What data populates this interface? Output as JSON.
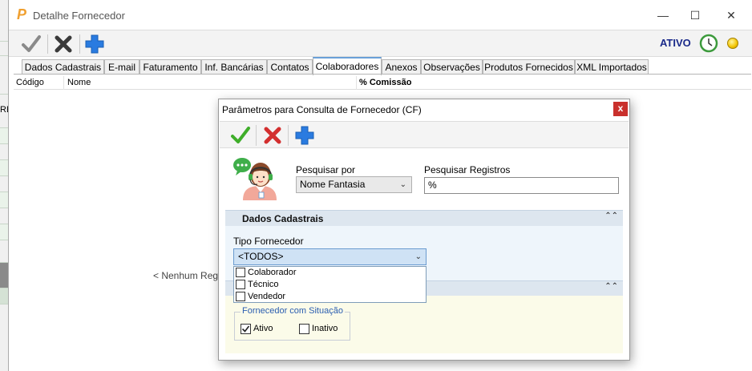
{
  "window": {
    "title": "Detalhe Fornecedor",
    "status": "ATIVO",
    "controls": {
      "minimize": "—",
      "maximize": "☐",
      "close": "✕"
    }
  },
  "tabs": [
    {
      "label": "Dados Cadastrais"
    },
    {
      "label": "E-mail"
    },
    {
      "label": "Faturamento"
    },
    {
      "label": "Inf. Bancárias"
    },
    {
      "label": "Contatos"
    },
    {
      "label": "Colaboradores",
      "active": true
    },
    {
      "label": "Anexos"
    },
    {
      "label": "Observações"
    },
    {
      "label": "Produtos Fornecidos"
    },
    {
      "label": "XML Importados"
    }
  ],
  "grid": {
    "columns": [
      "Código",
      "Nome",
      "% Comissão"
    ],
    "empty_message": "< Nenhum Regist",
    "side_fragment": "RE"
  },
  "dialog": {
    "title": "Parâmetros para Consulta de  Fornecedor (CF)",
    "close": "x",
    "pesquisar_por_label": "Pesquisar por",
    "pesquisar_por_value": "Nome Fantasia",
    "pesquisar_registros_label": "Pesquisar Registros",
    "pesquisar_registros_value": "%",
    "section1_title": "Dados Cadastrais",
    "tipo_label": "Tipo Fornecedor",
    "tipo_value": "<TODOS>",
    "tipo_options": [
      {
        "label": "Colaborador",
        "checked": false
      },
      {
        "label": "Técnico",
        "checked": false
      },
      {
        "label": "Vendedor",
        "checked": false
      }
    ],
    "situacao_legend": "Fornecedor com Situação",
    "situacao_options": [
      {
        "label": "Ativo",
        "checked": true
      },
      {
        "label": "Inativo",
        "checked": false
      }
    ]
  },
  "colors": {
    "accent_blue": "#1a5fb4",
    "status_text": "#1a2a8a",
    "confirm_green": "#3fae2a",
    "cancel_red": "#d32f2f",
    "section_bar": "#dde6ef"
  }
}
